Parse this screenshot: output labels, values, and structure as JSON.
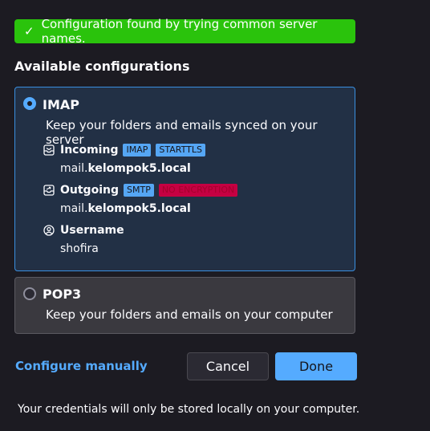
{
  "banner": {
    "check_glyph": "✓",
    "text": "Configuration found by trying common server names."
  },
  "section_title": "Available configurations",
  "configs": [
    {
      "protocol": "IMAP",
      "description": "Keep your folders and emails synced on your server",
      "selected": true,
      "incoming": {
        "label": "Incoming",
        "badges": [
          "IMAP",
          "STARTTLS"
        ],
        "host_prefix": "mail.",
        "host_domain": "kelompok5.local"
      },
      "outgoing": {
        "label": "Outgoing",
        "badges": [
          "SMTP"
        ],
        "warning_badge": "NO ENCRYPTION",
        "host_prefix": "mail.",
        "host_domain": "kelompok5.local"
      },
      "username": {
        "label": "Username",
        "value": "shofira"
      }
    },
    {
      "protocol": "POP3",
      "description": "Keep your folders and emails on your computer",
      "selected": false
    }
  ],
  "actions": {
    "manual_link": "Configure manually",
    "cancel": "Cancel",
    "done": "Done"
  },
  "footer_note": "Your credentials will only be stored locally on your computer.",
  "colors": {
    "background": "#1c1b22",
    "success": "#2ac30c",
    "accent": "#55abff",
    "danger": "#c50042"
  },
  "icons": {
    "banner": "check-icon",
    "incoming": "inbox-icon",
    "outgoing": "outbox-icon",
    "username": "user-circle-icon"
  }
}
